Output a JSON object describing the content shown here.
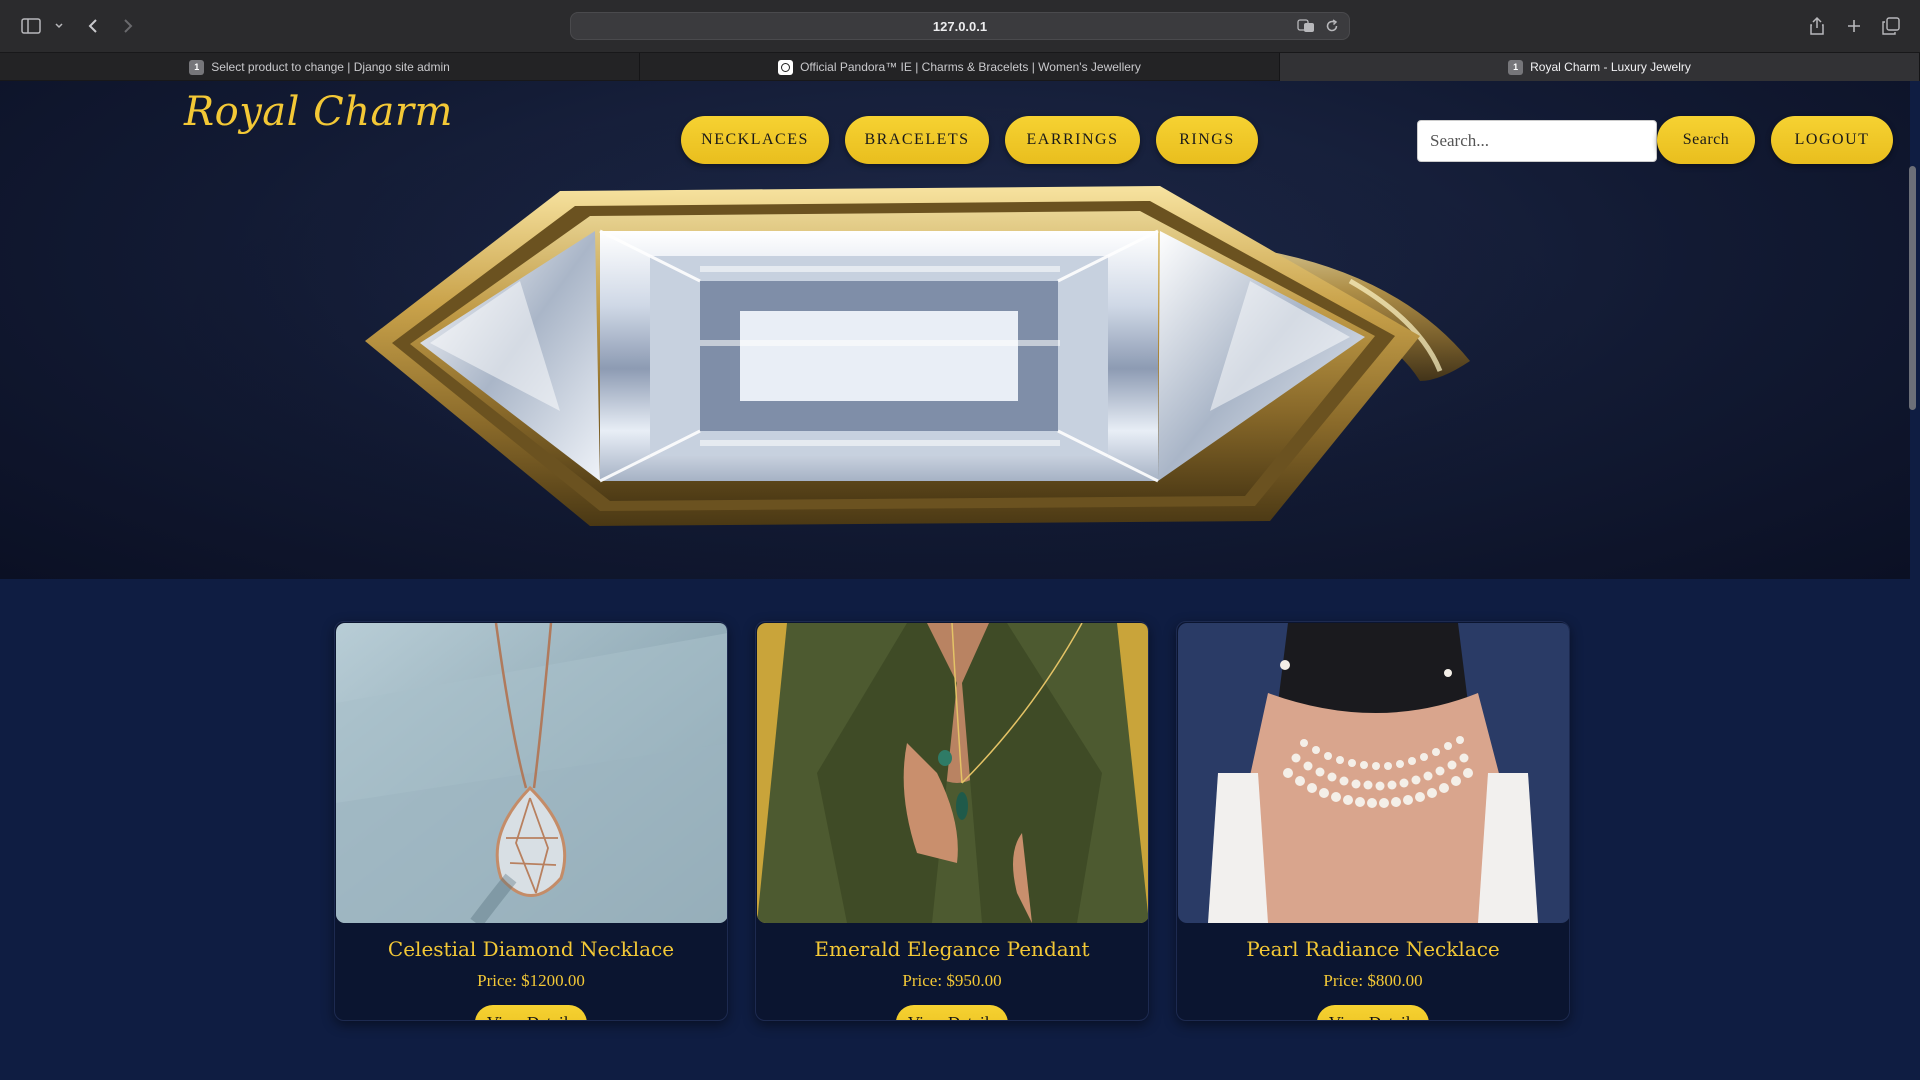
{
  "browser": {
    "url": "127.0.0.1",
    "tabs": [
      {
        "favicon": "1",
        "title": "Select product to change | Django site admin"
      },
      {
        "favicon": "",
        "title": "Official Pandora™ IE | Charms & Bracelets | Women's Jewellery"
      },
      {
        "favicon": "1",
        "title": "Royal Charm - Luxury Jewelry"
      }
    ]
  },
  "site": {
    "brand": "Royal Charm",
    "nav": [
      "NECKLACES",
      "BRACELETS",
      "EARRINGS",
      "RINGS"
    ],
    "search": {
      "placeholder": "Search...",
      "button": "Search"
    },
    "logout": "LOGOUT"
  },
  "products": [
    {
      "name": "Celestial Diamond Necklace",
      "price": "Price: $1200.00",
      "button": "View Details"
    },
    {
      "name": "Emerald Elegance Pendant",
      "price": "Price: $950.00",
      "button": "View Details"
    },
    {
      "name": "Pearl Radiance Necklace",
      "price": "Price: $800.00",
      "button": "View Details"
    }
  ],
  "colors": {
    "gold": "#f3c836",
    "navy": "#0f1d42"
  }
}
